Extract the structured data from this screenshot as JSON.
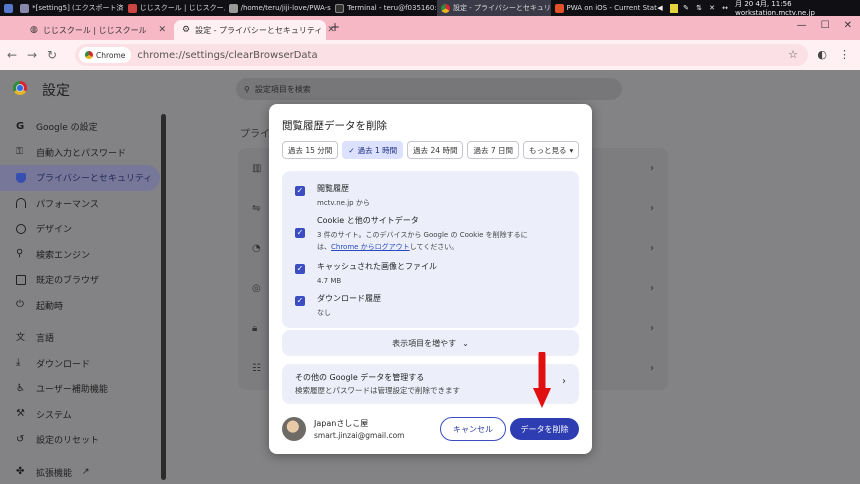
{
  "taskbar": {
    "items": [
      {
        "label": "*[setting5] (エクスポート済…"
      },
      {
        "label": "じじスクール | じじスクール"
      },
      {
        "label": "/home/teru/jiji-love/PWA-s…"
      },
      {
        "label": "Terminal - teru@f035160:…"
      },
      {
        "label": "設定 - プライバシーとセキュリ…"
      },
      {
        "label": "PWA on iOS - Current Stat…"
      }
    ],
    "clock": "月 20  4月, 11:56 workstation.mctv.ne.jp"
  },
  "tabs": [
    {
      "label": "じじスクール | じじスクール"
    },
    {
      "label": "設定 - プライバシーとセキュリティ"
    }
  ],
  "omnibox": {
    "chip": "Chrome",
    "url": "chrome://settings/clearBrowserData"
  },
  "settings": {
    "title": "設定",
    "search_placeholder": "設定項目を検索",
    "main_heading": "プライバ",
    "sidebar": [
      {
        "label": "Google の設定",
        "icon": "google-icon"
      },
      {
        "label": "自動入力とパスワード",
        "icon": "key-icon"
      },
      {
        "label": "プライバシーとセキュリティ",
        "icon": "shield-icon"
      },
      {
        "label": "パフォーマンス",
        "icon": "speedometer-icon"
      },
      {
        "label": "デザイン",
        "icon": "palette-icon"
      },
      {
        "label": "検索エンジン",
        "icon": "search-icon"
      },
      {
        "label": "既定のブラウザ",
        "icon": "browser-icon"
      },
      {
        "label": "起動時",
        "icon": "power-icon"
      },
      {
        "label": "言語",
        "icon": "translate-icon"
      },
      {
        "label": "ダウンロード",
        "icon": "download-icon"
      },
      {
        "label": "ユーザー補助機能",
        "icon": "accessibility-icon"
      },
      {
        "label": "システム",
        "icon": "wrench-icon"
      },
      {
        "label": "設定のリセット",
        "icon": "reset-icon"
      },
      {
        "label": "拡張機能",
        "icon": "puzzle-icon"
      }
    ]
  },
  "dialog": {
    "title": "閲覧履歴データを削除",
    "time_ranges": [
      {
        "label": "過去 15 分間"
      },
      {
        "label": "過去 1 時間",
        "selected": true
      },
      {
        "label": "過去 24 時間"
      },
      {
        "label": "過去 7 日間"
      },
      {
        "label": "もっと見る"
      }
    ],
    "checkboxes": [
      {
        "title": "閲覧履歴",
        "sub": "mctv.ne.jp から",
        "checked": true
      },
      {
        "title": "Cookie と他のサイトデータ",
        "sub1": "3 件のサイト。このデバイスから Google の Cookie を削除するに",
        "sub2_pre": "は、",
        "sub2_link": "Chrome からログアウト",
        "sub2_post": "してください。",
        "checked": true
      },
      {
        "title": "キャッシュされた画像とファイル",
        "sub": "4.7 MB",
        "checked": true
      },
      {
        "title": "ダウンロード履歴",
        "sub": "なし",
        "checked": true
      }
    ],
    "more_items": "表示項目を増やす",
    "manage_title": "その他の Google データを管理する",
    "manage_sub": "検索履歴とパスワードは管理設定で削除できます",
    "account_name": "Japanさしこ屋",
    "account_email": "smart.jinzai@gmail.com",
    "cancel": "キャンセル",
    "delete": "データを削除"
  },
  "colors": {
    "tab_strip": "#f6b8c4",
    "toolbar": "#fff1f3",
    "accent": "#2e3eb2",
    "arrow": "#e01010"
  }
}
